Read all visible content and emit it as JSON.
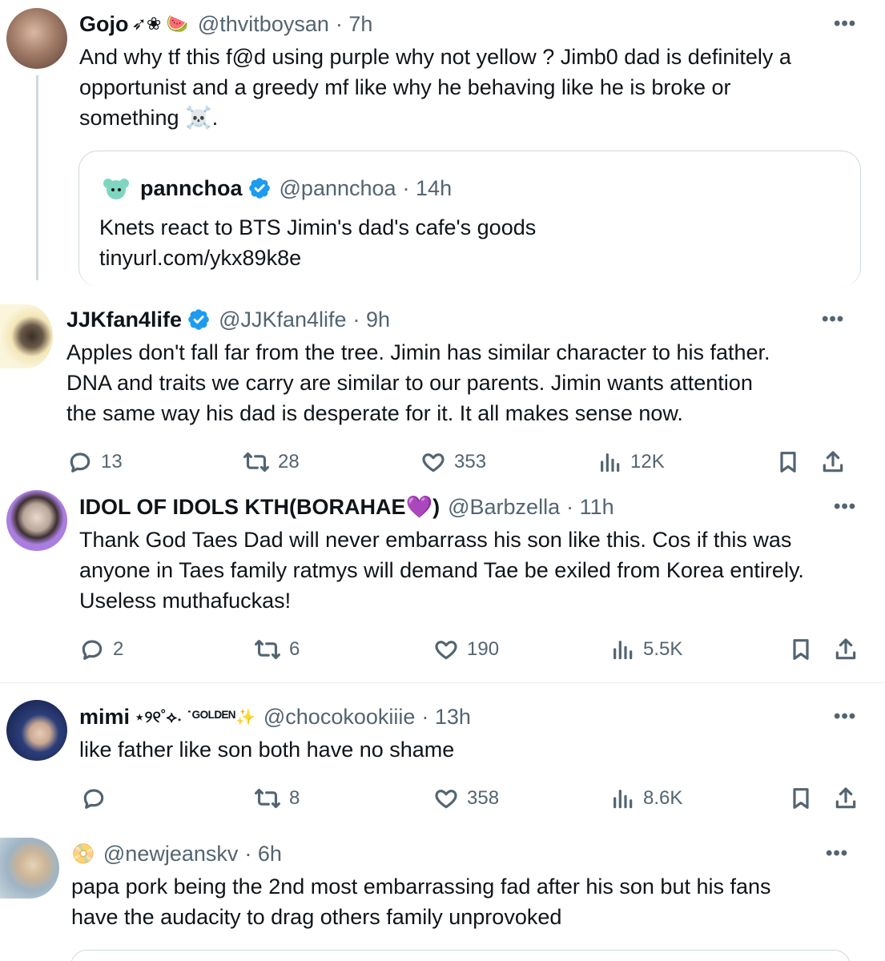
{
  "tweets": [
    {
      "name": "Gojo",
      "name_deco": "➶❀ 🍉",
      "handle": "@thvitboysan",
      "time": "· 7h",
      "text_lines": [
        "And why tf this f@d using purple why not yellow  ? Jimb0 dad is definitely a",
        "opportunist and a greedy mf like why he behaving like he is broke or",
        "something ☠️."
      ],
      "quote": {
        "name": "pannchoa",
        "handle": "@pannchoa",
        "time": "· 14h",
        "text": "Knets react to BTS  Jimin's dad's cafe's goods",
        "link": "tinyurl.com/ykx89k8e"
      }
    },
    {
      "name": "JJKfan4life",
      "handle": "@JJKfan4life",
      "time": "· 9h",
      "text_lines": [
        "Apples don't fall far from the tree. Jimin has similar character to his father.",
        "DNA and traits we carry are similar to our parents. Jimin wants attention",
        "the same way his dad is desperate for it. It all makes sense now."
      ],
      "replies": "13",
      "retweets": "28",
      "likes": "353",
      "views": "12K"
    },
    {
      "name": "IDOL OF IDOLS KTH(BORAHAE💜)",
      "handle": "@Barbzella",
      "time": "· 11h",
      "text_lines": [
        "Thank God Taes Dad will never embarrass his son like this. Cos if this was",
        "anyone in Taes family  ratmys will demand Tae be exiled from Korea entirely.",
        "Useless muthafuckas!"
      ],
      "replies": "2",
      "retweets": "6",
      "likes": "190",
      "views": "5.5K"
    },
    {
      "name": "mimi",
      "name_deco": "⋆୨୧˚⟡˖ ˙ᴳᴼᴸᴰᴱᴺ✨",
      "handle": "@chocokookiiie",
      "time": "· 13h",
      "text_lines": [
        "like father like son both have no shame"
      ],
      "replies": "",
      "retweets": "8",
      "likes": "358",
      "views": "8.6K"
    },
    {
      "name": "📀",
      "handle": "@newjeanskv",
      "time": "· 6h",
      "text_lines": [
        "papa pork being the 2nd most embarrassing fad after his son but his fans",
        "have the audacity to drag others family unprovoked"
      ]
    }
  ],
  "more_label": "•••",
  "colors": {
    "verified": "#1d9bf0",
    "muted": "#536471",
    "border": "#cfd9de"
  }
}
